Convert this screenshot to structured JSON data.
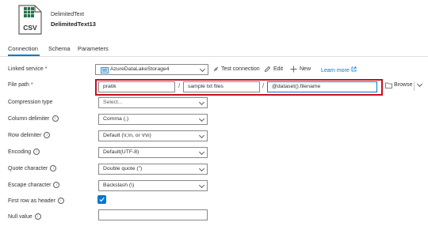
{
  "header": {
    "type_label": "DelimitedText",
    "dataset_name": "DelimitedText13",
    "icon_text": "CSV"
  },
  "tabs": [
    {
      "label": "Connection",
      "active": true
    },
    {
      "label": "Schema",
      "active": false
    },
    {
      "label": "Parameters",
      "active": false
    }
  ],
  "linked_service": {
    "label": "Linked service",
    "value": "AzureDataLakeStorage4",
    "test_connection": "Test connection",
    "edit": "Edit",
    "new": "New",
    "learn_more": "Learn more"
  },
  "file_path": {
    "label": "File path",
    "container": "pratik",
    "directory": "sample txt files",
    "filename": "@dataset().filename",
    "separator": "/",
    "browse": "Browse"
  },
  "fields": {
    "compression_type": {
      "label": "Compression type",
      "value": "Select..."
    },
    "column_delimiter": {
      "label": "Column delimiter",
      "value": "Comma (,)"
    },
    "row_delimiter": {
      "label": "Row delimiter",
      "value": "Default (\\r,\\n, or \\r\\n)"
    },
    "encoding": {
      "label": "Encoding",
      "value": "Default(UTF-8)"
    },
    "quote_character": {
      "label": "Quote character",
      "value": "Double quote (\")"
    },
    "escape_character": {
      "label": "Escape character",
      "value": "Backslash (\\)"
    },
    "first_row_as_header": {
      "label": "First row as header",
      "checked": true
    },
    "null_value": {
      "label": "Null value",
      "value": ""
    }
  },
  "colors": {
    "accent": "#0078d4",
    "highlight_box": "#c50f1f",
    "csv_green": "#217346"
  }
}
